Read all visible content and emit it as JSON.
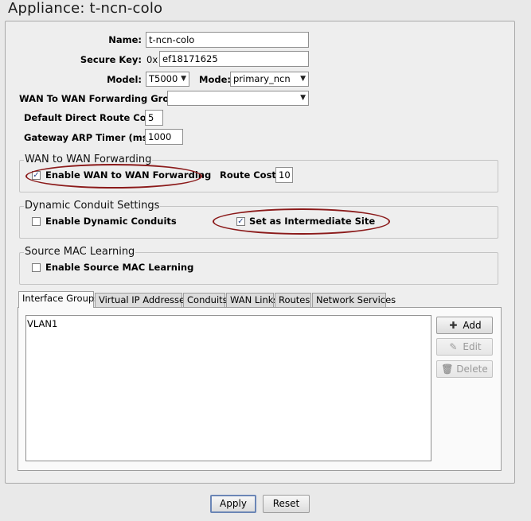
{
  "window": {
    "title": "Appliance: t-ncn-colo"
  },
  "form": {
    "name_label": "Name:",
    "name_value": "t-ncn-colo",
    "secure_key_label": "Secure Key:",
    "secure_key_prefix": "0x",
    "secure_key_value": "ef18171625",
    "model_label": "Model:",
    "model_value": "T5000",
    "mode_label": "Mode:",
    "mode_value": "primary_ncn",
    "wan_group_label": "WAN To WAN Forwarding Group:",
    "wan_group_value": "",
    "route_cost_label": "Default Direct Route Cost:",
    "route_cost_value": "5",
    "arp_label": "Gateway ARP Timer (ms):",
    "arp_value": "1000"
  },
  "wan_forwarding": {
    "title": "WAN to WAN Forwarding",
    "enable_label": "Enable WAN to WAN Forwarding",
    "enabled": true,
    "route_cost_label": "Route Cost:",
    "route_cost_value": "10"
  },
  "dynamic_conduit": {
    "title": "Dynamic Conduit Settings",
    "enable_label": "Enable Dynamic Conduits",
    "enabled": false,
    "intermediate_label": "Set as Intermediate Site",
    "intermediate": true
  },
  "mac_learning": {
    "title": "Source MAC Learning",
    "enable_label": "Enable Source MAC Learning",
    "enabled": false
  },
  "tabs": [
    {
      "label": "Interface Groups",
      "active": true
    },
    {
      "label": "Virtual IP Addresses"
    },
    {
      "label": "Conduits"
    },
    {
      "label": "WAN Links"
    },
    {
      "label": "Routes"
    },
    {
      "label": "Network Services"
    }
  ],
  "interface_groups": {
    "items": [
      "VLAN1"
    ]
  },
  "side_buttons": {
    "add": "Add",
    "edit": "Edit",
    "delete": "Delete"
  },
  "footer": {
    "apply": "Apply",
    "reset": "Reset"
  },
  "icons": {
    "add": "plus-icon",
    "edit": "pencil-icon",
    "delete": "trash-icon",
    "check": "checkmark-icon"
  },
  "colors": {
    "annotation": "#8b1a1a",
    "default_button_border": "#6b86b6"
  }
}
